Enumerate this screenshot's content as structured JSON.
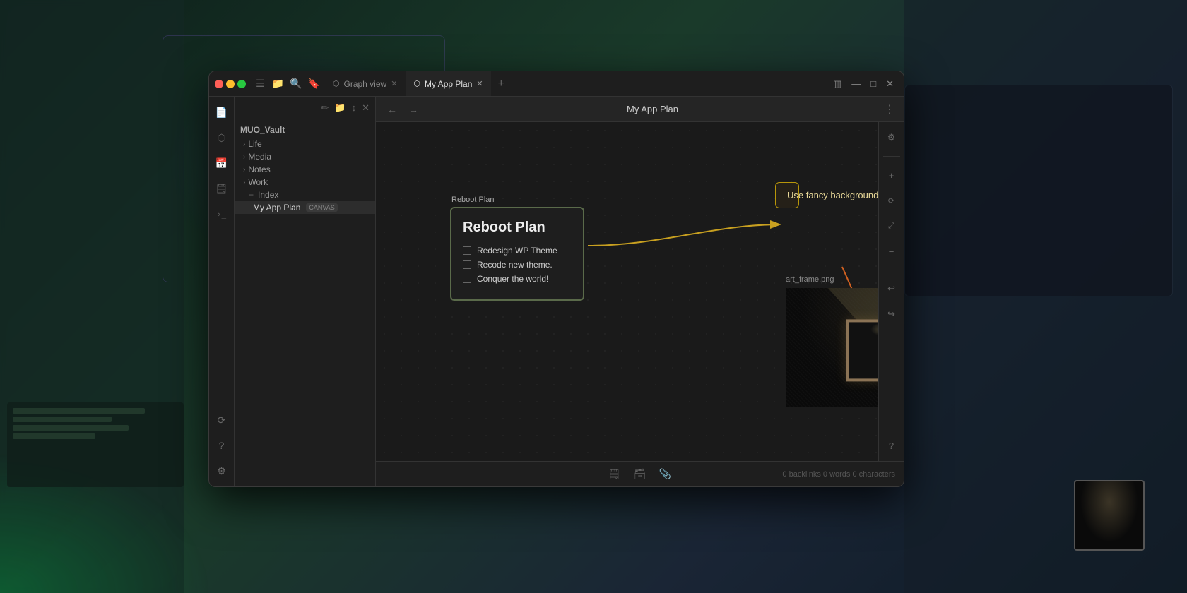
{
  "desktop": {
    "bg": "dark teal"
  },
  "window": {
    "title": "My App Plan"
  },
  "tabs": [
    {
      "id": "graph-view",
      "label": "Graph view",
      "icon": "⬡",
      "active": false
    },
    {
      "id": "my-app-plan",
      "label": "My App Plan",
      "icon": "⬡",
      "active": true
    }
  ],
  "tab_add_label": "+",
  "titlebar": {
    "minimize": "—",
    "maximize": "□",
    "close": "✕",
    "layout": "▥",
    "more": "⋮"
  },
  "sidebar": {
    "icons": [
      {
        "id": "ribbon-menu",
        "icon": "☰",
        "label": "ribbon-menu"
      },
      {
        "id": "files",
        "icon": "📁",
        "label": "files"
      },
      {
        "id": "search",
        "icon": "🔍",
        "label": "search"
      },
      {
        "id": "bookmarks",
        "icon": "🔖",
        "label": "bookmarks"
      },
      {
        "id": "graph",
        "icon": "⬡",
        "label": "graph"
      },
      {
        "id": "calendar",
        "icon": "📅",
        "label": "calendar"
      },
      {
        "id": "pages",
        "icon": "📄",
        "label": "pages"
      },
      {
        "id": "terminal",
        "icon": ">_",
        "label": "terminal"
      }
    ],
    "bottom_icons": [
      {
        "id": "sync",
        "icon": "⟳",
        "label": "sync"
      },
      {
        "id": "help",
        "icon": "?",
        "label": "help"
      },
      {
        "id": "settings",
        "icon": "⚙",
        "label": "settings"
      }
    ]
  },
  "file_explorer": {
    "root": "MUO_Vault",
    "actions": [
      "new-note",
      "new-folder",
      "sort",
      "collapse"
    ],
    "tree": [
      {
        "id": "life",
        "label": "Life",
        "type": "folder",
        "indent": 0
      },
      {
        "id": "media",
        "label": "Media",
        "type": "folder",
        "indent": 0
      },
      {
        "id": "notes",
        "label": "Notes",
        "type": "folder",
        "indent": 0
      },
      {
        "id": "work",
        "label": "Work",
        "type": "folder",
        "indent": 0
      },
      {
        "id": "index",
        "label": "Index",
        "type": "file",
        "indent": 1
      },
      {
        "id": "my-app-plan",
        "label": "My App Plan",
        "type": "file",
        "badge": "CANVAS",
        "indent": 1,
        "active": true
      }
    ]
  },
  "content": {
    "nav": {
      "back": "←",
      "forward": "→"
    },
    "title": "My App Plan",
    "more": "⋮"
  },
  "canvas": {
    "nodes": {
      "reboot_plan": {
        "label": "Reboot Plan",
        "title": "Reboot Plan",
        "tasks": [
          {
            "text": "Redesign WP Theme",
            "done": false
          },
          {
            "text": "Recode new theme.",
            "done": false
          },
          {
            "text": "Conquer the world!",
            "done": false
          }
        ]
      },
      "fancy_bg": {
        "text": "Use fancy backgrounds!"
      },
      "art_frame": {
        "label": "art_frame.png"
      }
    }
  },
  "right_panel": {
    "icons": [
      {
        "id": "properties",
        "icon": "⚙",
        "label": "properties"
      },
      {
        "id": "zoom-in",
        "icon": "+",
        "label": "zoom-in"
      },
      {
        "id": "reset",
        "icon": "⟳",
        "label": "reset-zoom"
      },
      {
        "id": "fit",
        "icon": "⤢",
        "label": "fit-view"
      },
      {
        "id": "zoom-out",
        "icon": "−",
        "label": "zoom-out"
      },
      {
        "id": "undo",
        "icon": "↩",
        "label": "undo"
      },
      {
        "id": "redo",
        "icon": "↪",
        "label": "redo"
      },
      {
        "id": "help",
        "icon": "?",
        "label": "help"
      }
    ]
  },
  "bottom_bar": {
    "buttons": [
      {
        "id": "new-note-card",
        "icon": "🗒",
        "label": "new-note-card"
      },
      {
        "id": "new-media-card",
        "icon": "🗃",
        "label": "new-media-card"
      },
      {
        "id": "embed-file",
        "icon": "📎",
        "label": "embed-file"
      }
    ],
    "stats": "0 backlinks  0 words  0 characters"
  },
  "explorer_action_icons": {
    "new_note": "✏",
    "new_folder": "📁",
    "sort": "↕",
    "collapse": "✕"
  }
}
